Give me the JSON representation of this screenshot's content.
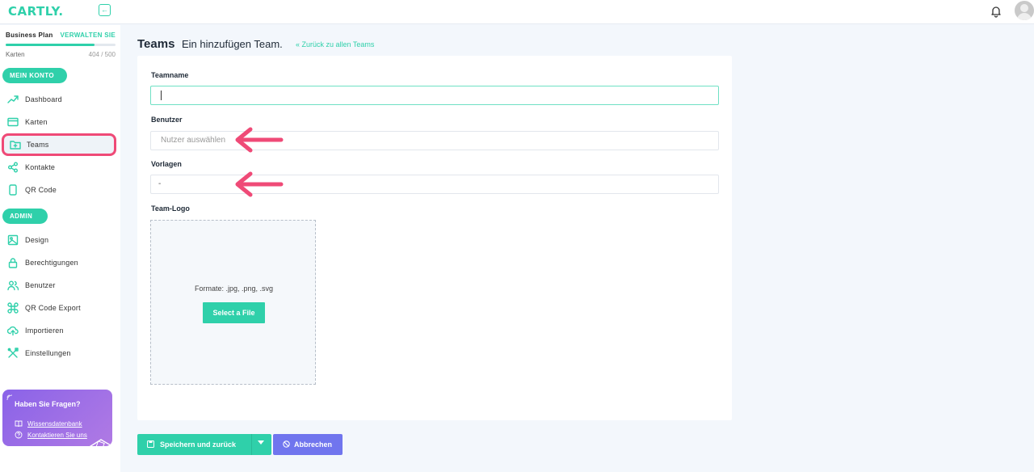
{
  "app": {
    "logo": "CARTLY."
  },
  "plan": {
    "name": "Business Plan",
    "manage": "VERWALTEN SIE",
    "metric": "Karten",
    "count": "404 / 500",
    "progress": 0.808
  },
  "sidebar": {
    "section_account": "MEIN KONTO",
    "section_admin": "ADMIN",
    "items": [
      {
        "label": "Dashboard",
        "icon": "trending-up-icon"
      },
      {
        "label": "Karten",
        "icon": "card-icon"
      },
      {
        "label": "Teams",
        "icon": "folder-plus-icon",
        "active": true
      },
      {
        "label": "Kontakte",
        "icon": "share-icon"
      },
      {
        "label": "QR Code",
        "icon": "phone-icon"
      }
    ],
    "admin_items": [
      {
        "label": "Design",
        "icon": "image-icon"
      },
      {
        "label": "Berechtigungen",
        "icon": "lock-icon"
      },
      {
        "label": "Benutzer",
        "icon": "users-icon"
      },
      {
        "label": "QR Code Export",
        "icon": "command-icon"
      },
      {
        "label": "Importieren",
        "icon": "upload-cloud-icon"
      },
      {
        "label": "Einstellungen",
        "icon": "tools-icon"
      }
    ]
  },
  "help": {
    "title": "Haben Sie Fragen?",
    "knowledge_base": "Wissensdatenbank",
    "contact": "Kontaktieren Sie uns"
  },
  "header": {
    "title": "Teams",
    "subtitle": "Ein hinzufügen Team.",
    "back": "Zurück zu allen Teams"
  },
  "form": {
    "team_name": {
      "label": "Teamname",
      "value": ""
    },
    "users": {
      "label": "Benutzer",
      "placeholder": "Nutzer auswählen"
    },
    "templates": {
      "label": "Vorlagen",
      "value": "-"
    },
    "logo": {
      "label": "Team-Logo",
      "formats": "Formate: .jpg, .png, .svg",
      "button": "Select a File"
    }
  },
  "actions": {
    "save": "Speichern und zurück",
    "cancel": "Abbrechen"
  },
  "colors": {
    "accent": "#2fd0aa",
    "cancel": "#7075ee",
    "highlight": "#ef4a77",
    "help_card": "#9a6fe6"
  }
}
